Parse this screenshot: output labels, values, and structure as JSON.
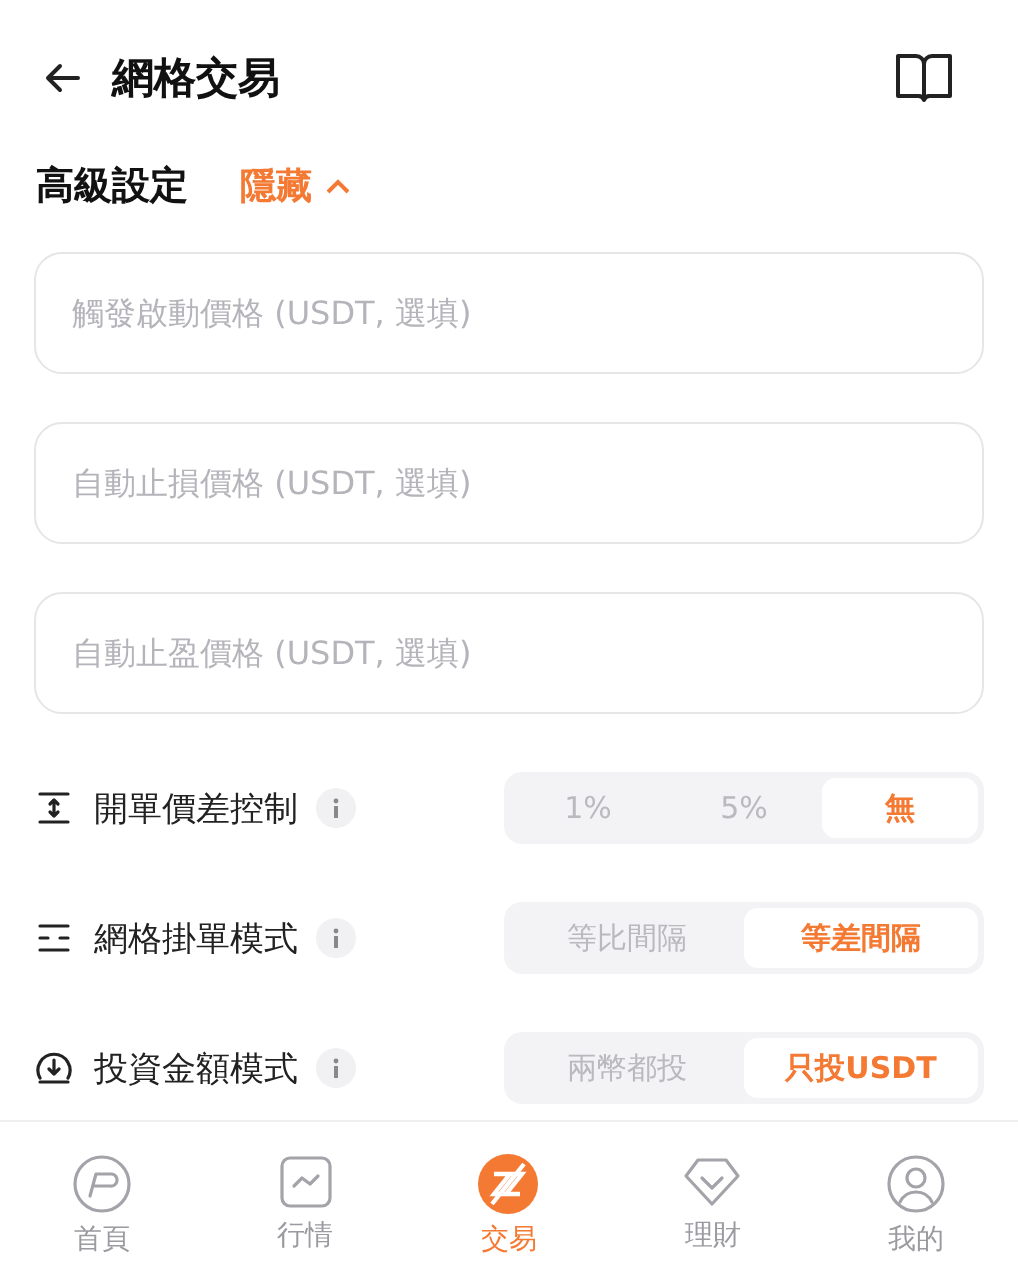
{
  "header": {
    "title": "網格交易"
  },
  "advanced": {
    "label": "高級設定",
    "toggle": "隱藏",
    "expanded": true
  },
  "fields": [
    {
      "placeholder": "觸發啟動價格 (USDT, 選填)"
    },
    {
      "placeholder": "自動止損價格 (USDT, 選填)"
    },
    {
      "placeholder": "自動止盈價格 (USDT, 選填)"
    }
  ],
  "settings": [
    {
      "kind": "spread",
      "label": "開單價差控制",
      "options": [
        {
          "label": "1%",
          "selected": false
        },
        {
          "label": "5%",
          "selected": false
        },
        {
          "label": "無",
          "selected": true
        }
      ]
    },
    {
      "kind": "grid",
      "label": "網格掛單模式",
      "options": [
        {
          "label": "等比間隔",
          "selected": false
        },
        {
          "label": "等差間隔",
          "selected": true
        }
      ]
    },
    {
      "kind": "invest",
      "label": "投資金額模式",
      "options": [
        {
          "label": "兩幣都投",
          "selected": false
        },
        {
          "label": "只投USDT",
          "selected": true
        }
      ]
    }
  ],
  "tabs": [
    {
      "kind": "home",
      "label": "首頁",
      "selected": false
    },
    {
      "kind": "market",
      "label": "行情",
      "selected": false
    },
    {
      "kind": "trade",
      "label": "交易",
      "selected": true
    },
    {
      "kind": "finance",
      "label": "理財",
      "selected": false
    },
    {
      "kind": "profile",
      "label": "我的",
      "selected": false
    }
  ]
}
